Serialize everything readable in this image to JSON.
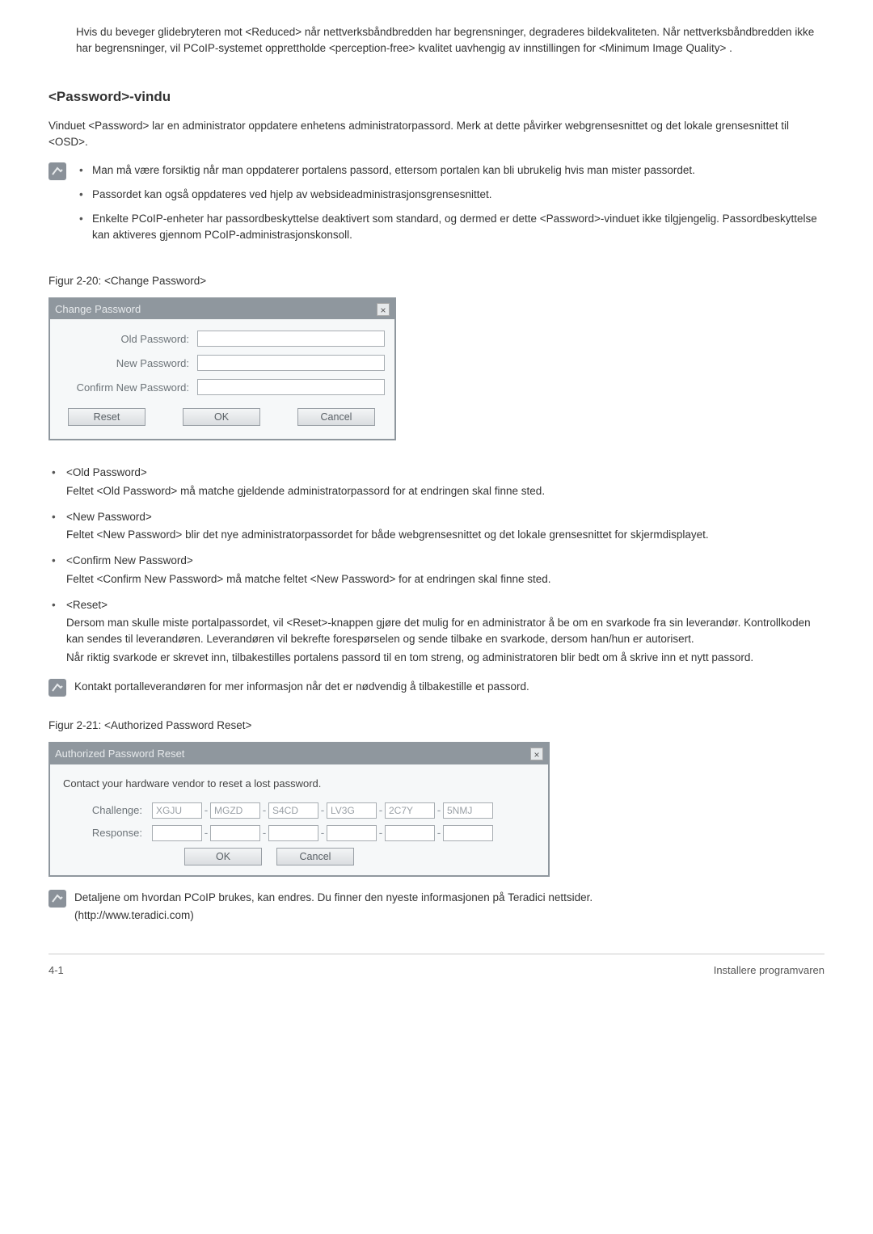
{
  "intro": "Hvis du beveger glidebryteren mot <Reduced> når nettverksbåndbredden har begrensninger, degraderes bildekvaliteten. Når nettverksbåndbredden ikke har begrensninger, vil PCoIP-systemet opprettholde <perception-free> kvalitet uavhengig av innstillingen for <Minimum Image Quality> .",
  "section_title": "<Password>-vindu",
  "section_desc": "Vinduet <Password> lar en administrator oppdatere enhetens administratorpassord. Merk at dette påvirker webgrensesnittet og det lokale grensesnittet til <OSD>.",
  "note1": {
    "items": [
      "Man må være forsiktig når man oppdaterer portalens passord, ettersom portalen kan bli ubrukelig hvis man mister passordet.",
      "Passordet kan også oppdateres ved hjelp av websideadministrasjonsgrensesnittet.",
      "Enkelte PCoIP-enheter har passordbeskyttelse deaktivert som standard, og dermed er dette <Password>-vinduet ikke tilgjengelig. Passordbeskyttelse kan aktiveres gjennom PCoIP-administrasjonskonsoll."
    ]
  },
  "fig1_caption": "Figur 2-20: <Change Password>",
  "dialog1": {
    "title": "Change Password",
    "close": "×",
    "labels": {
      "old": "Old Password:",
      "new": "New Password:",
      "confirm": "Confirm New Password:"
    },
    "buttons": {
      "reset": "Reset",
      "ok": "OK",
      "cancel": "Cancel"
    }
  },
  "fields": {
    "old": {
      "name": "<Old Password>",
      "desc": "Feltet <Old Password> må matche gjeldende administratorpassord for at endringen skal finne sted."
    },
    "new": {
      "name": "<New Password>",
      "desc": "Feltet <New Password> blir det nye administratorpassordet for både webgrensesnittet og det lokale grensesnittet for skjermdisplayet."
    },
    "confirm": {
      "name": "<Confirm New Password>",
      "desc": "Feltet <Confirm New Password> må matche feltet <New Password> for at endringen skal finne sted."
    },
    "reset": {
      "name": "<Reset>",
      "desc1": "Dersom man skulle miste portalpassordet, vil <Reset>-knappen gjøre det mulig for en administrator å be om en svarkode fra sin leverandør. Kontrollkoden kan sendes til leverandøren. Leverandøren vil bekrefte forespørselen og sende tilbake en svarkode, dersom han/hun er autorisert.",
      "desc2": "Når riktig svarkode er skrevet inn, tilbakestilles portalens passord til en tom streng, og administratoren blir bedt om å skrive inn et nytt passord."
    }
  },
  "note2": "Kontakt portalleverandøren for mer informasjon når det er nødvendig å tilbakestille et passord.",
  "fig2_caption": "Figur 2-21: <Authorized Password Reset>",
  "dialog2": {
    "title": "Authorized Password Reset",
    "close": "×",
    "instr": "Contact your hardware vendor to reset a lost password.",
    "challenge_label": "Challenge:",
    "response_label": "Response:",
    "challenge": [
      "XGJU",
      "MGZD",
      "S4CD",
      "LV3G",
      "2C7Y",
      "5NMJ"
    ],
    "buttons": {
      "ok": "OK",
      "cancel": "Cancel"
    }
  },
  "note3": {
    "line1": "Detaljene om hvordan PCoIP brukes, kan endres. Du finner den nyeste informasjonen på Teradici nettsider.",
    "line2": "(http://www.teradici.com)"
  },
  "footer": {
    "left": "4-1",
    "right": "Installere programvaren"
  }
}
